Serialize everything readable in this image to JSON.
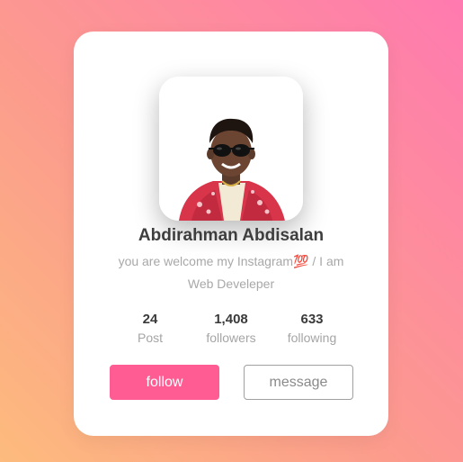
{
  "profile": {
    "name": "Abdirahman Abdisalan",
    "bio": "you are welcome my Instagram💯 / I am Web Develeper"
  },
  "stats": [
    {
      "value": "24",
      "label": "Post"
    },
    {
      "value": "1,408",
      "label": "followers"
    },
    {
      "value": "633",
      "label": "following"
    }
  ],
  "actions": {
    "follow_label": "follow",
    "message_label": "message"
  },
  "colors": {
    "accent": "#ff5c93",
    "background_start": "#fdbb7d",
    "background_end": "#ff7ab0"
  },
  "icons": {
    "avatar": "profile-photo"
  }
}
